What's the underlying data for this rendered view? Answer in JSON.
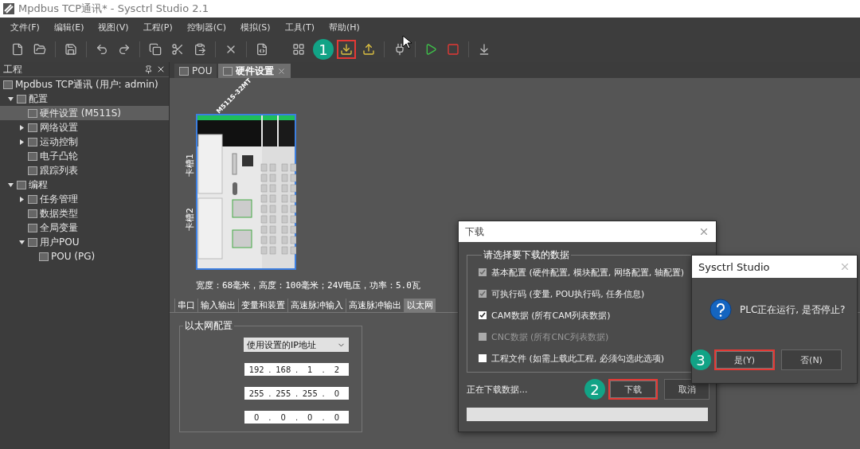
{
  "window": {
    "title": "Mpdbus TCP通讯* - Sysctrl Studio 2.1"
  },
  "menu": [
    "文件(F)",
    "编辑(E)",
    "视图(V)",
    "工程(P)",
    "控制器(C)",
    "模拟(S)",
    "工具(T)",
    "帮助(H)"
  ],
  "toolbar": [
    {
      "kind": "new",
      "highlighted": false
    },
    {
      "kind": "open",
      "highlighted": false
    },
    {
      "kind": "separator"
    },
    {
      "kind": "save",
      "highlighted": false
    },
    {
      "kind": "separator"
    },
    {
      "kind": "undo",
      "highlighted": false
    },
    {
      "kind": "redo",
      "highlighted": false
    },
    {
      "kind": "separator"
    },
    {
      "kind": "copy",
      "highlighted": false
    },
    {
      "kind": "cut",
      "highlighted": false
    },
    {
      "kind": "paste",
      "highlighted": false
    },
    {
      "kind": "separator"
    },
    {
      "kind": "delete",
      "highlighted": false
    },
    {
      "kind": "separator"
    },
    {
      "kind": "compile",
      "highlighted": false
    },
    {
      "kind": "gap"
    },
    {
      "kind": "network",
      "highlighted": false
    },
    {
      "kind": "download",
      "highlighted": true,
      "badge": "1"
    },
    {
      "kind": "upload",
      "highlighted": false
    },
    {
      "kind": "separator"
    },
    {
      "kind": "connect",
      "highlighted": false
    },
    {
      "kind": "separator"
    },
    {
      "kind": "run",
      "highlighted": false
    },
    {
      "kind": "stop",
      "highlighted": false
    },
    {
      "kind": "separator"
    },
    {
      "kind": "reset",
      "highlighted": false
    }
  ],
  "project_panel": {
    "title": "工程",
    "tree": [
      {
        "label": "Mpdbus TCP通讯 (用户: admin)",
        "selected": false,
        "children": [
          {
            "label": "配置",
            "selected": false,
            "expanded": true,
            "children": [
              {
                "label": "硬件设置 (M511S)",
                "selected": true
              },
              {
                "label": "网络设置",
                "selected": false,
                "expanded": false
              },
              {
                "label": "运动控制",
                "selected": false,
                "expanded": false
              },
              {
                "label": "电子凸轮",
                "selected": false
              },
              {
                "label": "跟踪列表",
                "selected": false
              }
            ]
          },
          {
            "label": "编程",
            "selected": false,
            "expanded": true,
            "children": [
              {
                "label": "任务管理",
                "selected": false,
                "expanded": false
              },
              {
                "label": "数据类型",
                "selected": false
              },
              {
                "label": "全局变量",
                "selected": false
              },
              {
                "label": "用户POU",
                "selected": false,
                "expanded": true,
                "children": [
                  {
                    "label": "POU (PG)",
                    "selected": false
                  }
                ]
              }
            ]
          }
        ]
      }
    ]
  },
  "editor_tabs": [
    {
      "label": "POU",
      "selected": false,
      "closable": false
    },
    {
      "label": "硬件设置",
      "selected": true,
      "closable": true
    }
  ],
  "hardware": {
    "module_label": "M511S-32MT",
    "slots": [
      "卡槽1",
      "卡槽2"
    ],
    "caption": "宽度：68毫米，高度：100毫米；24V电压，功率：5.0瓦"
  },
  "config_tabs": [
    {
      "label": "串口",
      "selected": false
    },
    {
      "label": "输入输出",
      "selected": false
    },
    {
      "label": "变量和装置",
      "selected": false
    },
    {
      "label": "高速脉冲输入",
      "selected": false
    },
    {
      "label": "高速脉冲输出",
      "selected": false
    },
    {
      "label": "以太网",
      "selected": true
    }
  ],
  "ethernet": {
    "title": "以太网配置",
    "mode": "使用设置的IP地址",
    "separator": ".",
    "addresses": [
      [
        "192",
        "168",
        "1",
        "2"
      ],
      [
        "255",
        "255",
        "255",
        "0"
      ],
      [
        "0",
        "0",
        "0",
        "0"
      ]
    ]
  },
  "download_dialog": {
    "title": "下载",
    "group_title": "请选择要下载的数据",
    "options": [
      {
        "label": "基本配置",
        "detail": "(硬件配置, 模块配置, 网络配置, 轴配置)",
        "checked": true,
        "disabled": true
      },
      {
        "label": "可执行码",
        "detail": "(变量, POU执行码, 任务信息)",
        "checked": true,
        "disabled": true
      },
      {
        "label": "CAM数据",
        "detail": "(所有CAM列表数据)",
        "checked": true,
        "disabled": false
      },
      {
        "label": "CNC数据",
        "detail": "(所有CNC列表数据)",
        "checked": false,
        "disabled": true
      },
      {
        "label": "工程文件",
        "detail": "(如需上载此工程, 必须勾选此选项)",
        "checked": false,
        "disabled": false
      }
    ],
    "status": "正在下载数据...",
    "progress": {
      "level": 0
    },
    "buttons": [
      {
        "label": "下载",
        "highlighted": true,
        "badge": "2"
      },
      {
        "label": "取消",
        "highlighted": false
      }
    ]
  },
  "confirm_dialog": {
    "title": "Sysctrl Studio",
    "message": "PLC正在运行, 是否停止?",
    "buttons": [
      {
        "label": "是(Y)",
        "highlighted": true,
        "badge": "3"
      },
      {
        "label": "否(N)",
        "highlighted": false
      }
    ]
  }
}
